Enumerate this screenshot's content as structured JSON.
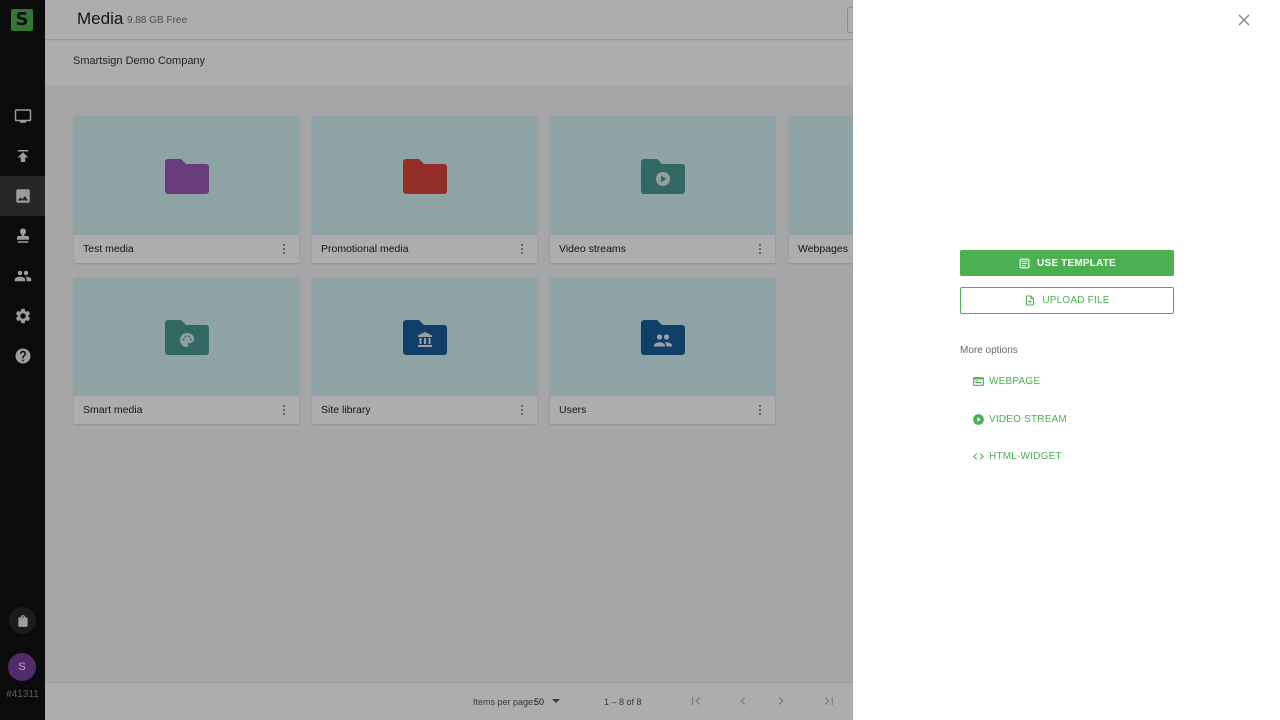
{
  "app": {
    "logo_letter": "S",
    "brand_color": "#4caf50"
  },
  "header": {
    "title": "Media",
    "storage": "9.88 GB Free"
  },
  "breadcrumb": {
    "company": "Smartsign Demo Company"
  },
  "sidebar": {
    "items": [
      {
        "name": "displays",
        "icon": "monitor-icon"
      },
      {
        "name": "publish",
        "icon": "upload-icon"
      },
      {
        "name": "media",
        "icon": "image-icon",
        "active": true
      },
      {
        "name": "approvals",
        "icon": "stamp-icon"
      },
      {
        "name": "users",
        "icon": "people-icon"
      },
      {
        "name": "settings",
        "icon": "gear-icon"
      },
      {
        "name": "help",
        "icon": "help-icon"
      }
    ],
    "store_icon": "shopping-bag-icon",
    "avatar_letter": "S",
    "account_id": "#41311"
  },
  "folders": [
    {
      "name": "Test media",
      "color": "#9b59b6",
      "icon": "folder-icon"
    },
    {
      "name": "Promotional media",
      "color": "#d9453d",
      "icon": "folder-icon"
    },
    {
      "name": "Video streams",
      "color": "#4a9a93",
      "icon": "play-folder-icon"
    },
    {
      "name": "Webpages",
      "color": "#4a9a93",
      "icon": "folder-icon"
    },
    {
      "name": "Smart media",
      "color": "#4a9a93",
      "icon": "palette-folder-icon"
    },
    {
      "name": "Site library",
      "color": "#1a5e9a",
      "icon": "library-folder-icon"
    },
    {
      "name": "Users",
      "color": "#1a5e9a",
      "icon": "users-folder-icon"
    }
  ],
  "pagination": {
    "items_per_page_label": "Items per page:",
    "items_per_page": "50",
    "range": "1 – 8 of 8"
  },
  "panel": {
    "use_template": "USE TEMPLATE",
    "upload_file": "UPLOAD FILE",
    "more_options": "More options",
    "options": [
      {
        "label": "WEBPAGE",
        "icon": "webpage-icon"
      },
      {
        "label": "VIDEO STREAM",
        "icon": "play-circle-icon"
      },
      {
        "label": "HTML-WIDGET",
        "icon": "code-icon"
      }
    ]
  }
}
